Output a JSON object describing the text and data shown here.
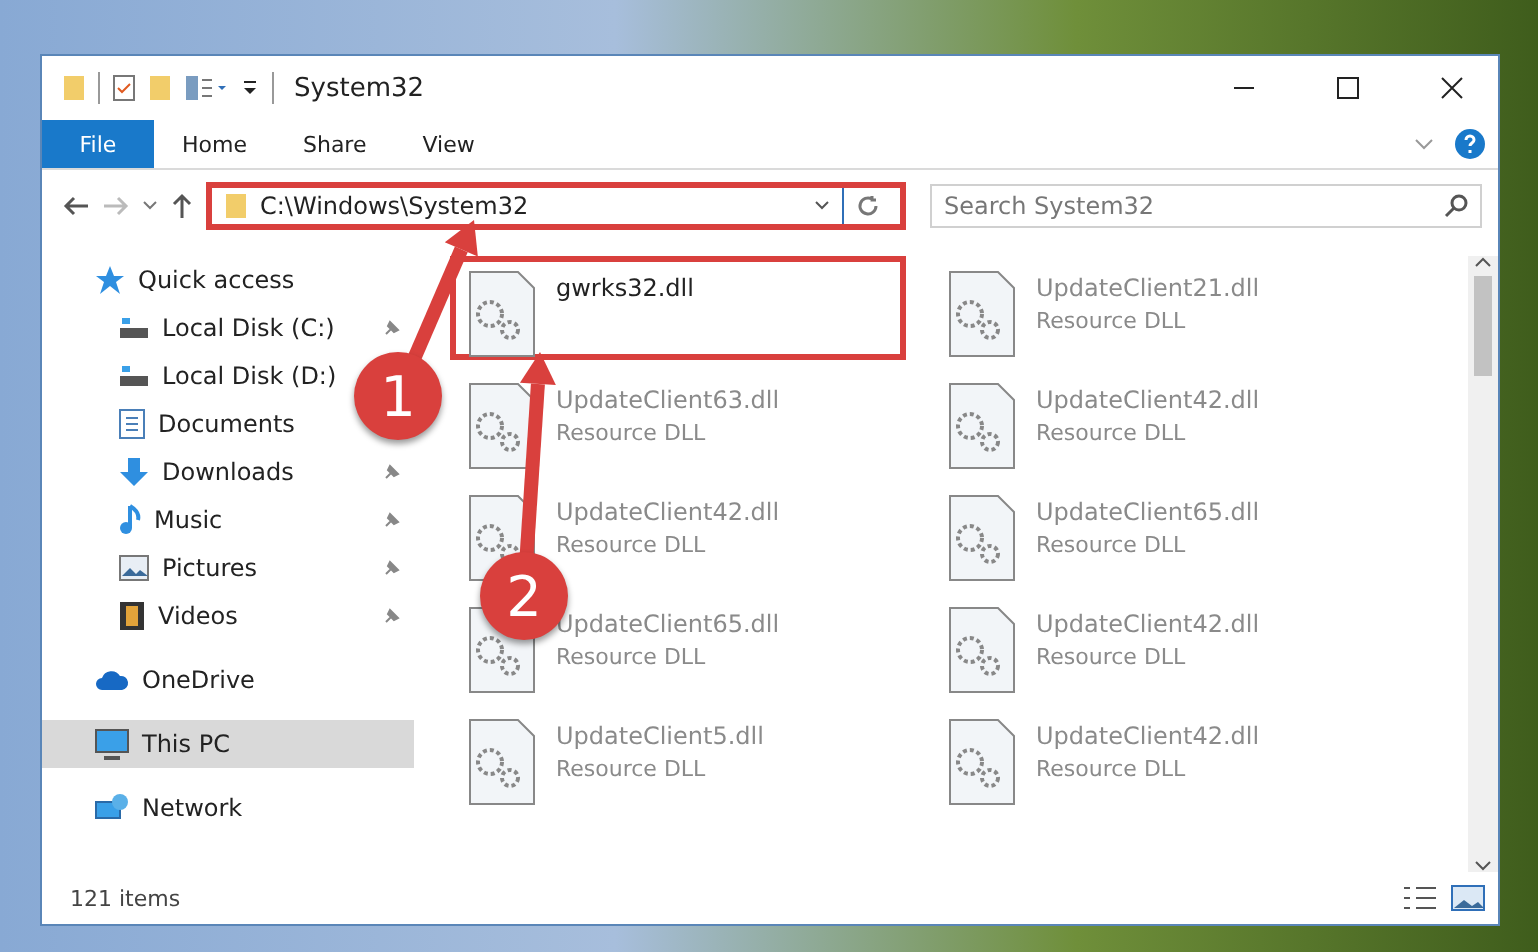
{
  "window": {
    "title": "System32"
  },
  "ribbon": {
    "tabs": [
      {
        "label": "File",
        "selected": true
      },
      {
        "label": "Home",
        "selected": false
      },
      {
        "label": "Share",
        "selected": false
      },
      {
        "label": "View",
        "selected": false
      }
    ]
  },
  "address": {
    "path": "C:\\Windows\\System32",
    "highlighted": true
  },
  "search": {
    "placeholder": "Search System32"
  },
  "sidebar": {
    "items": [
      {
        "label": "Quick access",
        "kind": "star",
        "selected": false,
        "children": [
          {
            "label": "Local Disk (C:)",
            "kind": "drive",
            "pinned": true,
            "selected": false
          },
          {
            "label": "Local Disk (D:)",
            "kind": "drive",
            "pinned": false,
            "selected": false
          },
          {
            "label": "Documents",
            "kind": "document",
            "pinned": false,
            "selected": false
          },
          {
            "label": "Downloads",
            "kind": "download",
            "pinned": true,
            "selected": false
          },
          {
            "label": "Music",
            "kind": "music",
            "pinned": true,
            "selected": false
          },
          {
            "label": "Pictures",
            "kind": "picture",
            "pinned": true,
            "selected": false
          },
          {
            "label": "Videos",
            "kind": "video",
            "pinned": true,
            "selected": false
          }
        ]
      },
      {
        "label": "OneDrive",
        "kind": "cloud",
        "selected": false
      },
      {
        "label": "This PC",
        "kind": "computer",
        "selected": true
      },
      {
        "label": "Network",
        "kind": "network",
        "selected": false
      }
    ]
  },
  "files": [
    {
      "name": "gwrks32.dll",
      "highlighted": true,
      "dimmed": false
    },
    {
      "name": "UpdateClient21.dll",
      "type": "Resource DLL",
      "highlighted": false,
      "dimmed": true
    },
    {
      "name": "UpdateClient63.dll",
      "type": "Resource DLL",
      "highlighted": false,
      "dimmed": true
    },
    {
      "name": "UpdateClient42.dll",
      "type": "Resource DLL",
      "highlighted": false,
      "dimmed": true
    },
    {
      "name": "UpdateClient42.dll",
      "type": "Resource DLL",
      "highlighted": false,
      "dimmed": true
    },
    {
      "name": "UpdateClient65.dll",
      "type": "Resource DLL",
      "highlighted": false,
      "dimmed": true
    },
    {
      "name": "UpdateClient65.dll",
      "type": "Resource DLL",
      "highlighted": false,
      "dimmed": true
    },
    {
      "name": "UpdateClient42.dll",
      "type": "Resource DLL",
      "highlighted": false,
      "dimmed": true
    },
    {
      "name": "UpdateClient5.dll",
      "type": "Resource DLL",
      "highlighted": false,
      "dimmed": true
    },
    {
      "name": "UpdateClient42.dll",
      "type": "Resource DLL",
      "highlighted": false,
      "dimmed": true
    }
  ],
  "status_bar": {
    "count": "121 items"
  },
  "callouts": [
    {
      "number": "1"
    },
    {
      "number": "2"
    }
  ]
}
